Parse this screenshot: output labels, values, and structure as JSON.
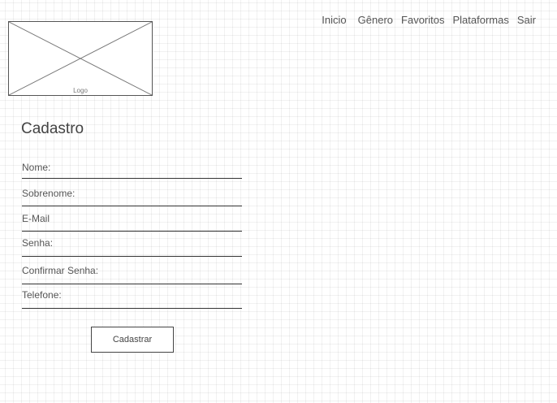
{
  "logo": {
    "label": "Logo"
  },
  "nav": {
    "items": [
      {
        "label": "Inicio"
      },
      {
        "label": "Gênero"
      },
      {
        "label": "Favoritos"
      },
      {
        "label": "Plataformas"
      },
      {
        "label": "Sair"
      }
    ]
  },
  "form": {
    "title": "Cadastro",
    "fields": [
      {
        "label": "Nome:"
      },
      {
        "label": "Sobrenome:"
      },
      {
        "label": "E-Mail"
      },
      {
        "label": "Senha:"
      },
      {
        "label": "Confirmar Senha:"
      },
      {
        "label": "Telefone:"
      }
    ],
    "submit_label": "Cadastrar"
  }
}
